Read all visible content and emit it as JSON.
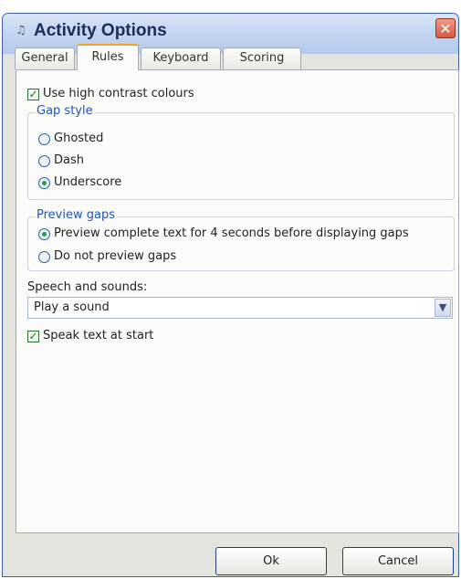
{
  "window": {
    "title": "Activity Options",
    "close_glyph": "✕",
    "app_icon_glyph": "♫"
  },
  "tabs": [
    {
      "label": "General"
    },
    {
      "label": "Rules",
      "active": true
    },
    {
      "label": "Keyboard"
    },
    {
      "label": "Scoring"
    }
  ],
  "rules": {
    "high_contrast": {
      "label": "Use high contrast colours",
      "checked": true
    },
    "gap_style": {
      "label": "Gap style",
      "options": [
        {
          "label": "Ghosted",
          "selected": false
        },
        {
          "label": "Dash",
          "selected": false
        },
        {
          "label": "Underscore",
          "selected": true
        }
      ]
    },
    "preview_gaps": {
      "label": "Preview gaps",
      "options": [
        {
          "label": "Preview complete text for 4 seconds before displaying gaps",
          "selected": true
        },
        {
          "label": "Do not preview gaps",
          "selected": false
        }
      ]
    },
    "speech": {
      "label": "Speech and sounds:",
      "selected_value": "Play a sound",
      "dropdown_glyph": "▼"
    },
    "speak_text": {
      "label": "Speak text at start",
      "checked": true
    }
  },
  "buttons": {
    "ok": "Ok",
    "cancel": "Cancel"
  },
  "icons": {
    "checkmark": "✓"
  },
  "colors": {
    "title_bar": "#c5d6f1",
    "group_label": "#1f55b8",
    "active_tab_accent": "#f2a32b",
    "close_button": "#d45a3f"
  }
}
